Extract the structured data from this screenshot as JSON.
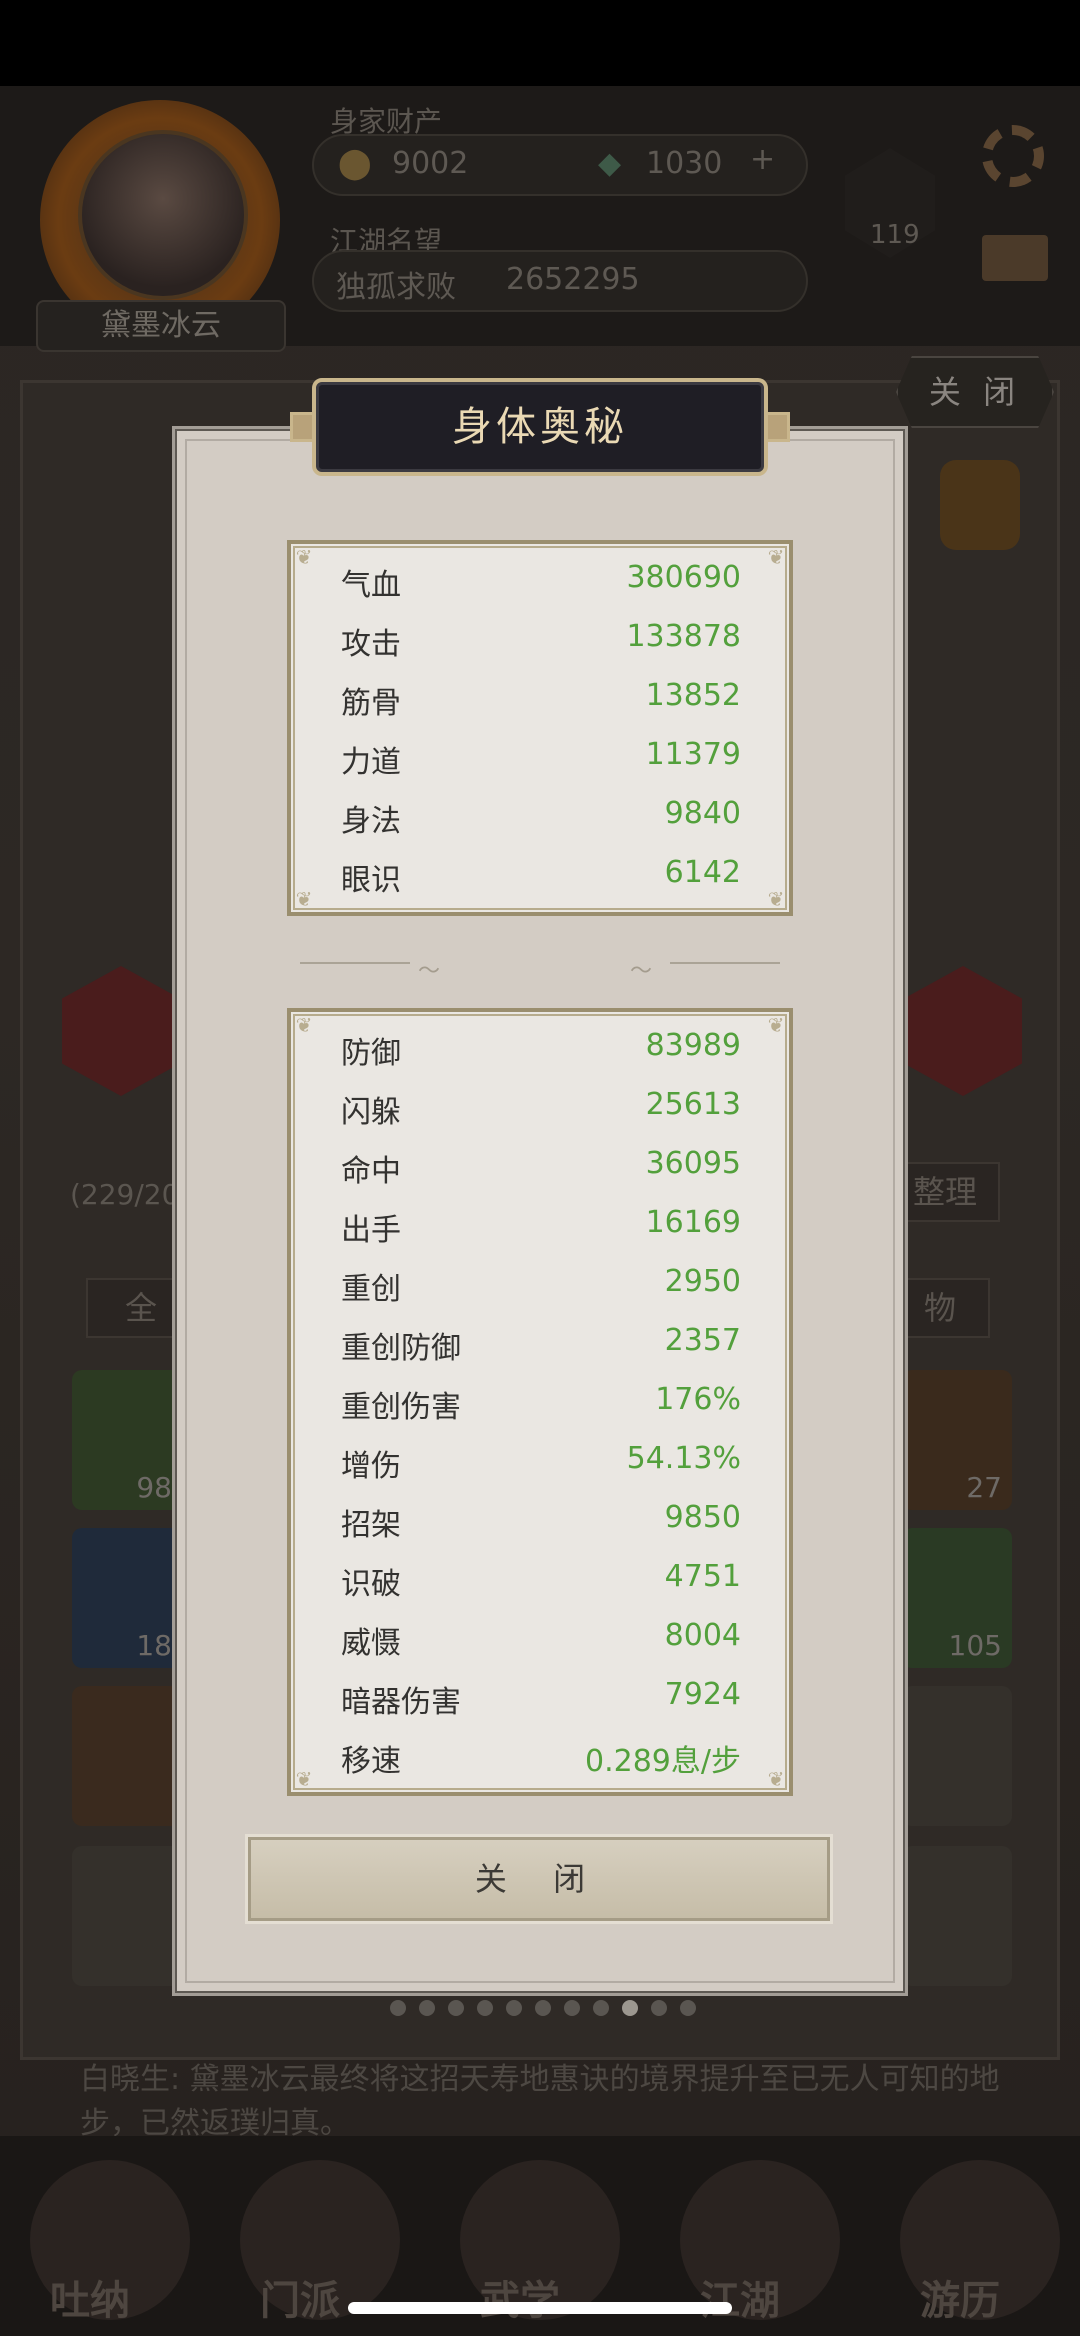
{
  "background": {
    "player_name": "黛墨冰云",
    "assets_label": "身家财产",
    "gold": "9002",
    "jade": "1030",
    "add_symbol": "+",
    "fame_label": "江湖名望",
    "fame_title": "独孤求败",
    "fame_value": "2652295",
    "level": "119",
    "close_label": "关 闭",
    "partial_count": "(229/20",
    "organize_label": "整理",
    "filter_all": "全",
    "filter_item": "物",
    "slot_counts": [
      "98",
      "27",
      "18",
      "105"
    ],
    "story_text": "白晓生: 黛墨冰云最终将这招天寿地惠诀的境界提升至已无人可知的地步，已然返璞归真。",
    "nav": [
      "吐纳",
      "门派",
      "武学",
      "江湖",
      "游历"
    ]
  },
  "modal": {
    "title": "身体奥秘",
    "close_button": "关 闭",
    "base_stats": [
      {
        "label": "气血",
        "value": "380690"
      },
      {
        "label": "攻击",
        "value": "133878"
      },
      {
        "label": "筋骨",
        "value": "13852"
      },
      {
        "label": "力道",
        "value": "11379"
      },
      {
        "label": "身法",
        "value": "9840"
      },
      {
        "label": "眼识",
        "value": "6142"
      }
    ],
    "combat_stats": [
      {
        "label": "防御",
        "value": "83989"
      },
      {
        "label": "闪躲",
        "value": "25613"
      },
      {
        "label": "命中",
        "value": "36095"
      },
      {
        "label": "出手",
        "value": "16169"
      },
      {
        "label": "重创",
        "value": "2950"
      },
      {
        "label": "重创防御",
        "value": "2357"
      },
      {
        "label": "重创伤害",
        "value": "176%"
      },
      {
        "label": "增伤",
        "value": "54.13%"
      },
      {
        "label": "招架",
        "value": "9850"
      },
      {
        "label": "识破",
        "value": "4751"
      },
      {
        "label": "威慑",
        "value": "8004"
      },
      {
        "label": "暗器伤害",
        "value": "7924"
      },
      {
        "label": "移速",
        "value": "0.289息/步"
      }
    ]
  },
  "colors": {
    "stat_value": "#53a03c",
    "title_text": "#ead9b4",
    "panel_bg": "#eae7e2",
    "modal_bg": "#d3ccc4"
  },
  "icons": {
    "gold": "gold-ingot-icon",
    "jade": "jade-icon",
    "settings": "gear-icon",
    "mail": "mail-icon",
    "level": "yinyang-icon"
  },
  "pager": {
    "total": 11,
    "active": 9
  }
}
